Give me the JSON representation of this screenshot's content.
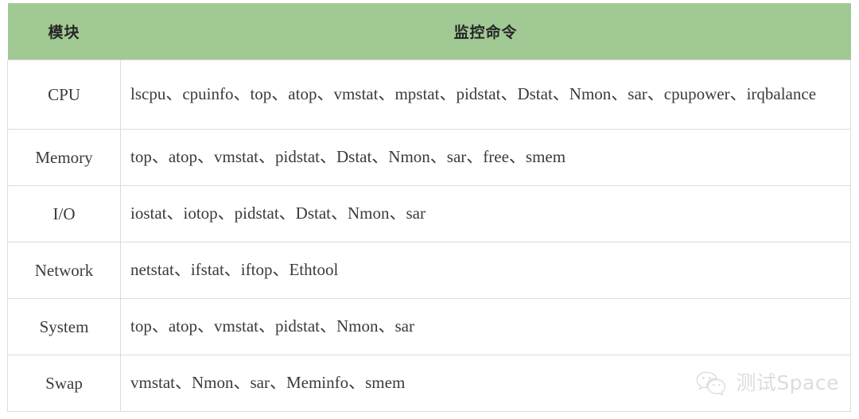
{
  "table": {
    "headers": {
      "module": "模块",
      "commands": "监控命令"
    },
    "header_bg_color": "#a1c994",
    "header_text_color": "#262626",
    "border_color": "#dcdcdc",
    "rows": [
      {
        "module": "CPU",
        "commands": "lscpu、cpuinfo、top、atop、vmstat、mpstat、pidstat、Dstat、Nmon、sar、cpupower、irqbalance"
      },
      {
        "module": "Memory",
        "commands": "top、atop、vmstat、pidstat、Dstat、Nmon、sar、free、smem"
      },
      {
        "module": "I/O",
        "commands": "iostat、iotop、pidstat、Dstat、Nmon、sar"
      },
      {
        "module": "Network",
        "commands": "netstat、ifstat、iftop、Ethtool"
      },
      {
        "module": "System",
        "commands": "top、atop、vmstat、pidstat、Nmon、sar"
      },
      {
        "module": "Swap",
        "commands": "vmstat、Nmon、sar、Meminfo、smem"
      }
    ]
  },
  "watermark": {
    "icon": "wechat-icon",
    "text": "测试Space",
    "color": "#8f8f8f"
  }
}
